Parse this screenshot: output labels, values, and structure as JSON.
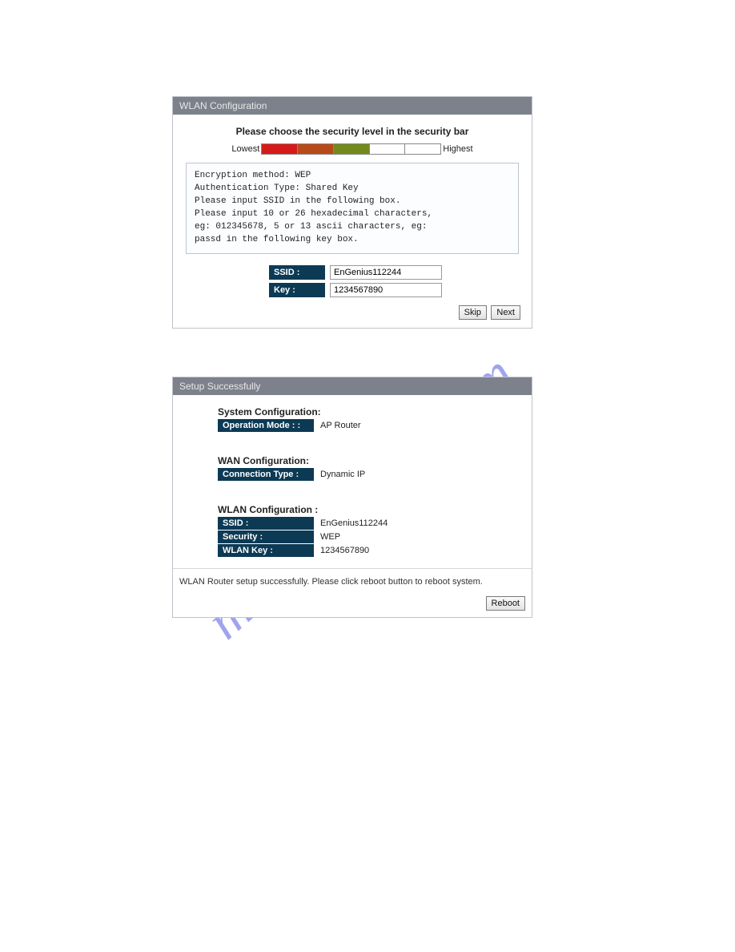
{
  "watermark": "manualshive.com",
  "wlan_config": {
    "header": "WLAN Configuration",
    "instruction": "Please choose the security level in the security bar",
    "low_label": "Lowest",
    "high_label": "Highest",
    "info_text": "Encryption method: WEP\nAuthentication Type: Shared Key\nPlease input SSID in the following box.\nPlease input 10 or 26 hexadecimal characters,\neg: 012345678, 5 or 13 ascii characters, eg:\npassd in the following key box.",
    "fields": {
      "ssid_label": "SSID :",
      "ssid_value": "EnGenius112244",
      "key_label": "Key :",
      "key_value": "1234567890"
    },
    "buttons": {
      "skip": "Skip",
      "next": "Next"
    }
  },
  "setup_success": {
    "header": "Setup Successfully",
    "sections": {
      "system": {
        "heading": "System Configuration:",
        "op_mode_label": "Operation Mode : :",
        "op_mode_value": "AP Router"
      },
      "wan": {
        "heading": "WAN Configuration:",
        "conn_type_label": "Connection Type :",
        "conn_type_value": "Dynamic IP"
      },
      "wlan": {
        "heading": "WLAN Configuration :",
        "ssid_label": "SSID :",
        "ssid_value": "EnGenius112244",
        "security_label": "Security :",
        "security_value": "WEP",
        "key_label": "WLAN Key :",
        "key_value": "1234567890"
      }
    },
    "footer_text": "WLAN Router setup successfully. Please click reboot button to reboot system.",
    "reboot_button": "Reboot"
  }
}
